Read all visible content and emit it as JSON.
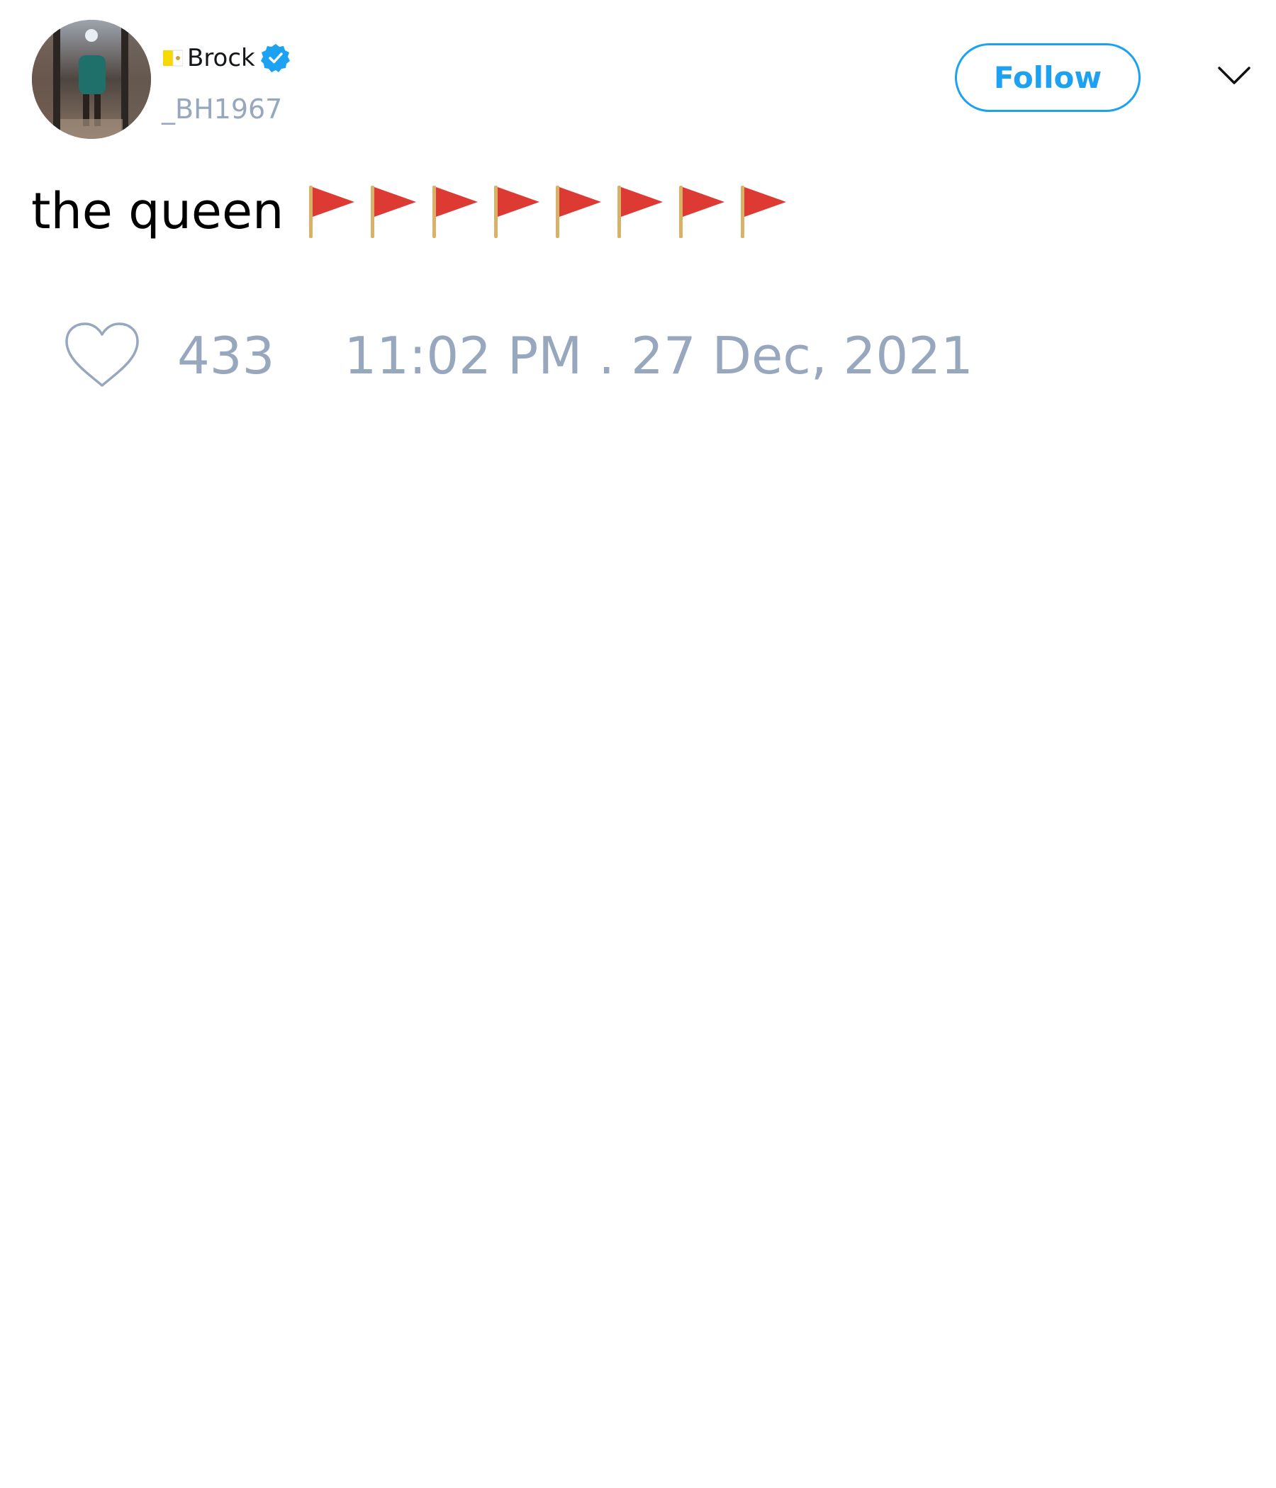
{
  "author": {
    "display_name": "Brock",
    "handle": "_BH1967",
    "verified": true,
    "name_prefix_icon": "vatican-flag-icon"
  },
  "header": {
    "follow_label": "Follow",
    "menu_icon": "chevron-down-icon"
  },
  "tweet": {
    "text": "the queen",
    "emoji_icon": "red-triangular-flag-icon",
    "emoji_count": 8
  },
  "footer": {
    "like_icon": "heart-icon",
    "like_count": "433",
    "timestamp": "11:02 PM . 27 Dec, 2021"
  },
  "colors": {
    "accent": "#1da1f2",
    "muted": "#97a7bd",
    "text": "#000000",
    "flag_red": "#dc3a33"
  }
}
